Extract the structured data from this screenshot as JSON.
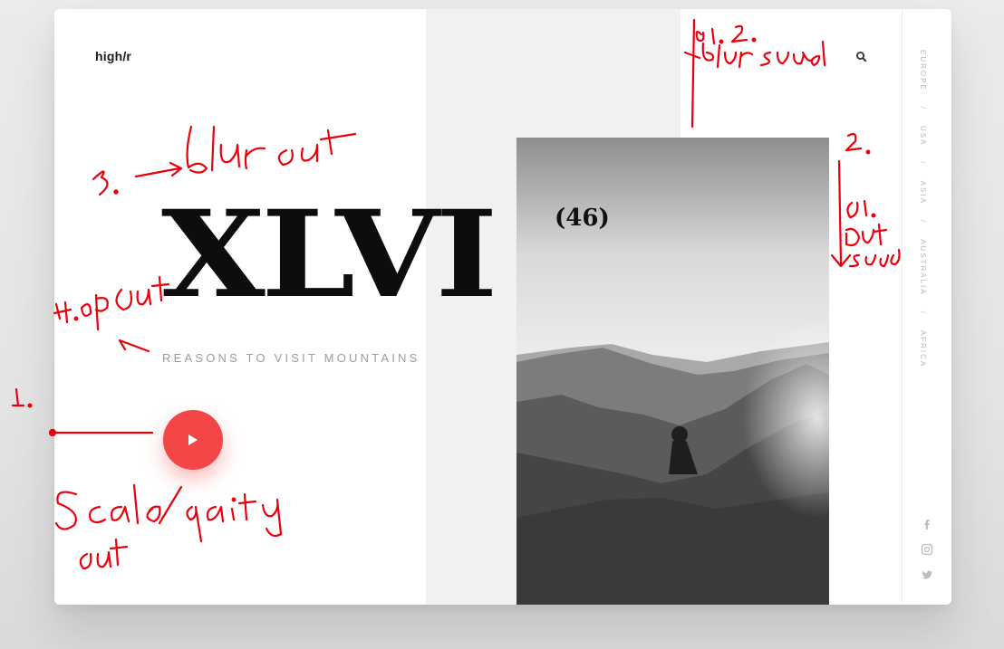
{
  "brand": {
    "logo": "high/r"
  },
  "hero": {
    "title": "XLVI",
    "count": "(46)",
    "subtitle": "REASONS TO VISIT MOUNTAINS"
  },
  "side_nav": {
    "regions": [
      "EUROPE",
      "USA",
      "ASIA",
      "AUSTRALIA",
      "AFRICA"
    ],
    "separator": "/",
    "social": [
      "facebook-icon",
      "instagram-icon",
      "twitter-icon"
    ]
  },
  "icons": {
    "search": "search-icon",
    "play": "play-icon"
  },
  "colors": {
    "accent": "#f44646",
    "annotation": "#e8000b",
    "headline": "#0d0d0d",
    "muted": "#9c9c9c"
  }
}
